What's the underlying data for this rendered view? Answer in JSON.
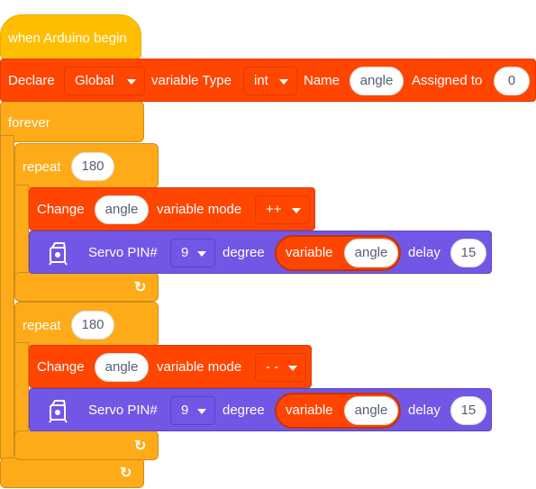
{
  "when_block": {
    "label": "when Arduino begin"
  },
  "declare_block": {
    "declare_label": "Declare",
    "scope": "Global",
    "variable_type_label": "variable Type",
    "type": "int",
    "name_label": "Name",
    "name": "angle",
    "assigned_label": "Assigned to",
    "value": "0"
  },
  "forever_block": {
    "label": "forever",
    "loop_icon": "loop-arrow-icon"
  },
  "loops": [
    {
      "repeat_label": "repeat",
      "count": "180",
      "change_label": "Change",
      "variable": "angle",
      "mode_label": "variable mode",
      "mode": "++",
      "servo_label": "Servo PIN#",
      "pin": "9",
      "degree_label": "degree",
      "variable_label": "variable",
      "degree_variable": "angle",
      "delay_label": "delay",
      "delay": "15"
    },
    {
      "repeat_label": "repeat",
      "count": "180",
      "change_label": "Change",
      "variable": "angle",
      "mode_label": "variable mode",
      "mode": "- -",
      "servo_label": "Servo PIN#",
      "pin": "9",
      "degree_label": "degree",
      "variable_label": "variable",
      "degree_variable": "angle",
      "delay_label": "delay",
      "delay": "15"
    }
  ],
  "colors": {
    "event": "#FFBF00",
    "control": "#FFAB19",
    "variables": "#FF4500",
    "servo": "#7256E5"
  }
}
